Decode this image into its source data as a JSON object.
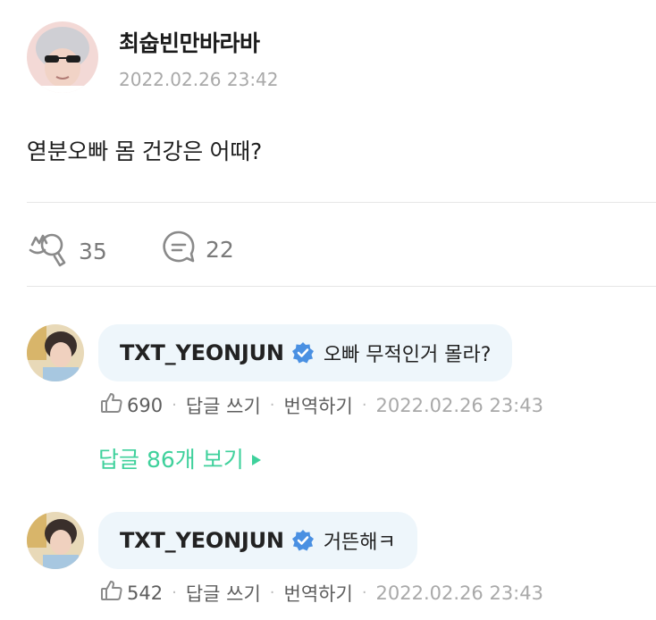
{
  "post": {
    "author": "최숩빈만바라바",
    "timestamp": "2022.02.26 23:42",
    "body": "엳분오빠 몸 건강은 어때?",
    "reactions_count": "35",
    "comments_count": "22"
  },
  "comments": [
    {
      "author": "TXT_YEONJUN",
      "text": "오빠 무적인거 몰라?",
      "likes": "690",
      "reply_label": "답글 쓰기",
      "translate_label": "번역하기",
      "timestamp": "2022.02.26 23:43"
    },
    {
      "author": "TXT_YEONJUN",
      "text": "거뜬해ㅋ",
      "likes": "542",
      "reply_label": "답글 쓰기",
      "translate_label": "번역하기",
      "timestamp": "2022.02.26 23:43"
    }
  ],
  "view_replies_label": "답글 86개 보기",
  "colors": {
    "accent_green": "#3fd19c",
    "verified_blue": "#4a90e2",
    "bubble_bg": "#eef6fb",
    "muted_text": "#a9a9a9"
  },
  "icons": {
    "reaction": "cheer-hands-icon",
    "comment": "speech-bubble-icon",
    "like": "thumbs-up-icon",
    "verified": "verified-badge-icon",
    "expand": "triangle-right-icon"
  }
}
